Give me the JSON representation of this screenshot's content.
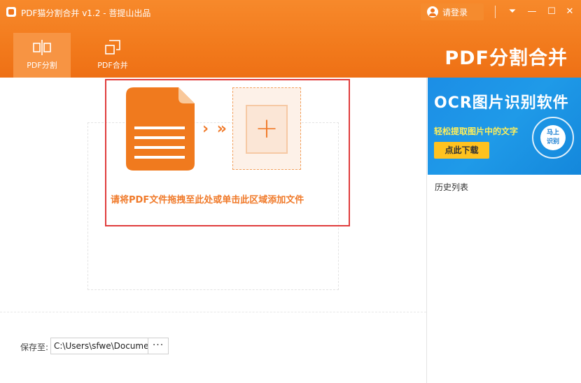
{
  "titlebar": {
    "title": "PDF猫分割合并 v1.2 - 菩提山出品",
    "login_label": "请登录",
    "menu_glyph": "⏷",
    "minimize_glyph": "—",
    "maximize_glyph": "☐",
    "close_glyph": "✕"
  },
  "tabs": [
    {
      "label": "PDF分割",
      "icon": "split-icon",
      "active": true
    },
    {
      "label": "PDF合并",
      "icon": "merge-icon",
      "active": false
    }
  ],
  "brand": {
    "text": "PDF分割合并"
  },
  "dropzone": {
    "arrows": "› »",
    "plus": "+",
    "hint": "请将PDF文件拖拽至此处或单击此区域添加文件"
  },
  "save": {
    "label": "保存至:",
    "path": "C:\\Users\\sfwe\\Documents",
    "browse_label": "···"
  },
  "sidebar": {
    "ad": {
      "title": "OCR图片识别软件",
      "subtitle": "轻松提取图片中的文字",
      "button": "点此下载",
      "badge_line1": "马上",
      "badge_line2": "识别"
    },
    "history_label": "历史列表"
  },
  "colors": {
    "header": "#f27a1c",
    "accent": "#f07a2a",
    "highlight_border": "#e03c3c",
    "ad_blue": "#1c8ee6",
    "ad_button": "#ffc21f"
  }
}
